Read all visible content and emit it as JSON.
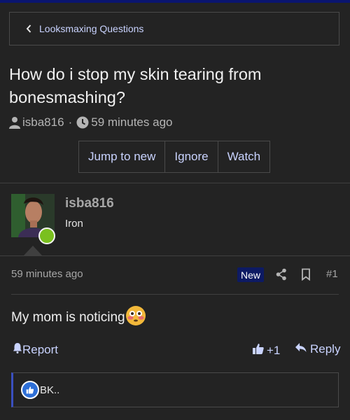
{
  "breadcrumb": {
    "label": "Looksmaxing Questions"
  },
  "thread": {
    "title": "How do i stop my skin tearing from bonesmashing?",
    "author": "isba816",
    "time": "59 minutes ago",
    "separator": "·"
  },
  "thread_actions": {
    "jump_to_new": "Jump to new",
    "ignore": "Ignore",
    "watch": "Watch"
  },
  "post": {
    "username": "isba816",
    "user_title": "Iron",
    "time": "59 minutes ago",
    "badge": "New",
    "number": "#1",
    "body_text": "My mom is noticing",
    "emoji": "flushed-face"
  },
  "post_actions": {
    "report": "Report",
    "like_count": "+1",
    "reply": "Reply"
  },
  "reactions": {
    "text": "BK.."
  },
  "colors": {
    "background": "#232323",
    "link": "#c9d3ff",
    "accent_bar": "#0a1570",
    "badge_bg": "#0d1a63",
    "online": "#7ac01f"
  }
}
